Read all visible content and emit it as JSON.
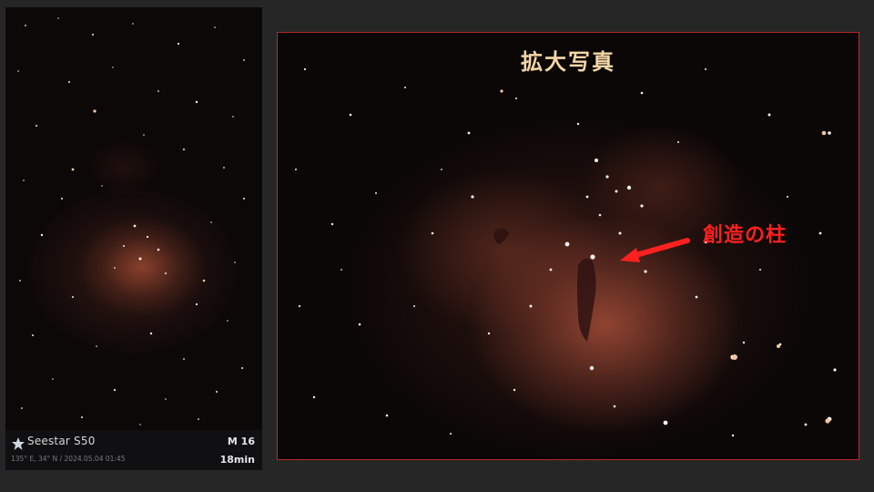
{
  "left_panel": {
    "brand": "Seestar S50",
    "coords": "135° E, 34° N / 2024.05.04 01:45",
    "target": "M 16",
    "exposure": "18min",
    "brand_icon": "star-logo-icon"
  },
  "right_panel": {
    "title": "拡大写真",
    "annotation": "創造の柱",
    "annotation_color": "#ff2020",
    "border_color": "#b52a24"
  }
}
